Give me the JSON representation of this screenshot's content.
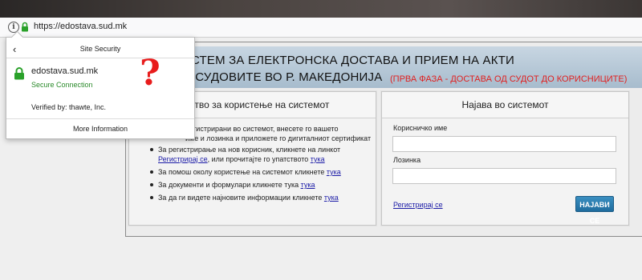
{
  "browser": {
    "url": "https://edostava.sud.mk",
    "info_icon_glyph": "i"
  },
  "popup": {
    "back_glyph": "‹",
    "title": "Site Security",
    "site": "edostava.sud.mk",
    "secure": "Secure Connection",
    "verified": "Verified by: thawte, Inc.",
    "more": "More Information",
    "secure_color": "#2a8a2a"
  },
  "annotation": {
    "glyph": "?",
    "color": "#e81c1c"
  },
  "banner": {
    "line1": "ИСТЕМ ЗА ЕЛЕКТРОНСКА ДОСТАВА И ПРИЕМ НА АКТИ",
    "line2": "О СУДОВИТЕ ВО Р. МАКЕДОНИЈА",
    "phase": "(ПРВА ФАЗА - ДОСТАВА ОД СУДОТ ДО КОРИСНИЦИТЕ)",
    "phase_color": "#e02020"
  },
  "instructions": {
    "title": "тство за користење на системот",
    "intro_l1": "регистрирани во системот, внесете го вашето",
    "intro_l2": "име и лозинка и приложете го дигиталниот сертификат",
    "bullets": [
      {
        "text": "За регистрирање на нов корисник, кликнете на линкот ",
        "link": "Регистрирај се",
        "after": ", или прочитајте го упатството ",
        "link2": "тука"
      },
      {
        "text": "За помош околу користење на системот кликнете ",
        "link": "тука"
      },
      {
        "text": "За документи и формулари кликнете тука ",
        "link": "тука"
      },
      {
        "text": "За да ги видете најновите информации кликнете ",
        "link": "тука"
      }
    ]
  },
  "login": {
    "title": "Најава во системот",
    "username_label": "Корисничко име",
    "password_label": "Лозинка",
    "register_link": "Регистрирај се",
    "submit": "НАЈАВИ СЕ",
    "accent": "#1f6c9e"
  }
}
